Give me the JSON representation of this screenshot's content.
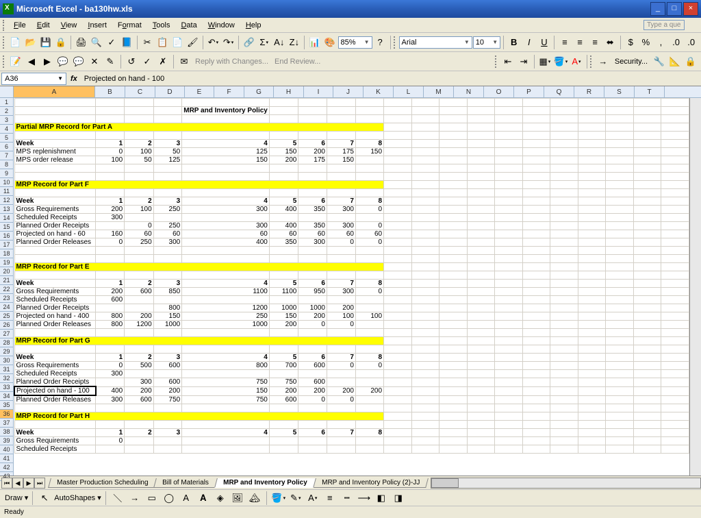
{
  "titlebar": {
    "app": "Microsoft Excel",
    "file": "ba130hw.xls"
  },
  "menus": [
    "File",
    "Edit",
    "View",
    "Insert",
    "Format",
    "Tools",
    "Data",
    "Window",
    "Help"
  ],
  "helpPlaceholder": "Type a que",
  "toolbar2": {
    "zoom": "85%",
    "font": "Arial",
    "size": "10"
  },
  "reviewing": {
    "reply": "Reply with Changes...",
    "end": "End Review..."
  },
  "security": "Security...",
  "namebox": "A36",
  "formula": "Projected on hand - 100",
  "draw": {
    "label": "Draw",
    "autoshapes": "AutoShapes"
  },
  "status": "Ready",
  "tabs": [
    "Master Production Scheduling",
    "Bill of Materials",
    "MRP and Inventory Policy",
    "MRP and Inventory Policy (2)-JJ"
  ],
  "activeTab": 2,
  "columns": [
    "A",
    "B",
    "C",
    "D",
    "E",
    "F",
    "G",
    "H",
    "I",
    "J",
    "K",
    "L",
    "M",
    "N",
    "O",
    "P",
    "Q",
    "R",
    "S",
    "T"
  ],
  "rows": 43,
  "selectedRow": 36,
  "cells": {
    "title": "MRP and Inventory Policy",
    "s1": {
      "header": "Partial MRP Record for Part A",
      "week": [
        "Week",
        "1",
        "2",
        "3",
        "4",
        "5",
        "6",
        "7",
        "8"
      ],
      "r1": [
        "MPS replenishment",
        "0",
        "100",
        "50",
        "125",
        "150",
        "200",
        "175",
        "150"
      ],
      "r2": [
        "MPS order release",
        "100",
        "50",
        "125",
        "150",
        "200",
        "175",
        "150",
        ""
      ]
    },
    "s2": {
      "header": "MRP Record for Part F",
      "week": [
        "Week",
        "1",
        "2",
        "3",
        "4",
        "5",
        "6",
        "7",
        "8"
      ],
      "r1": [
        "Gross Requirements",
        "200",
        "100",
        "250",
        "300",
        "400",
        "350",
        "300",
        "0"
      ],
      "r2": [
        "Scheduled Receipts",
        "300",
        "",
        "",
        "",
        "",
        "",
        "",
        ""
      ],
      "r3": [
        "Planned Order Receipts",
        "",
        "0",
        "250",
        "300",
        "400",
        "350",
        "300",
        "0"
      ],
      "r4": [
        "Projected on hand - 60",
        "160",
        "60",
        "60",
        "60",
        "60",
        "60",
        "60",
        "60"
      ],
      "r5": [
        "Planned Order Releases",
        "0",
        "250",
        "300",
        "400",
        "350",
        "300",
        "0",
        "0"
      ]
    },
    "s3": {
      "header": "MRP Record for Part E",
      "week": [
        "Week",
        "1",
        "2",
        "3",
        "4",
        "5",
        "6",
        "7",
        "8"
      ],
      "r1": [
        "Gross Requirements",
        "200",
        "600",
        "850",
        "1100",
        "1100",
        "950",
        "300",
        "0"
      ],
      "r2": [
        "Scheduled Receipts",
        "600",
        "",
        "",
        "",
        "",
        "",
        "",
        ""
      ],
      "r3": [
        "Planned Order Receipts",
        "",
        "",
        "800",
        "1200",
        "1000",
        "1000",
        "200",
        ""
      ],
      "r4": [
        "Projected on hand - 400",
        "800",
        "200",
        "150",
        "250",
        "150",
        "200",
        "100",
        "100"
      ],
      "r5": [
        "Planned Order Releases",
        "800",
        "1200",
        "1000",
        "1000",
        "200",
        "0",
        "0",
        ""
      ]
    },
    "s4": {
      "header": "MRP Record for Part G",
      "week": [
        "Week",
        "1",
        "2",
        "3",
        "4",
        "5",
        "6",
        "7",
        "8"
      ],
      "r1": [
        "Gross Requirements",
        "0",
        "500",
        "600",
        "800",
        "700",
        "600",
        "0",
        "0"
      ],
      "r2": [
        "Scheduled Receipts",
        "300",
        "",
        "",
        "",
        "",
        "",
        "",
        ""
      ],
      "r3": [
        "Planned Order Receipts",
        "",
        "300",
        "600",
        "750",
        "750",
        "600",
        "",
        ""
      ],
      "r4": [
        "Projected on hand - 100",
        "400",
        "200",
        "200",
        "150",
        "200",
        "200",
        "200",
        "200"
      ],
      "r5": [
        "Planned Order Releases",
        "300",
        "600",
        "750",
        "750",
        "600",
        "0",
        "0",
        ""
      ]
    },
    "s5": {
      "header": "MRP Record for Part H",
      "week": [
        "Week",
        "1",
        "2",
        "3",
        "4",
        "5",
        "6",
        "7",
        "8"
      ],
      "r1": [
        "Gross Requirements",
        "0",
        "",
        "",
        "",
        "",
        "",
        "",
        ""
      ],
      "r2": [
        "Scheduled Receipts",
        "",
        "",
        "",
        "",
        "",
        "",
        "",
        ""
      ]
    }
  }
}
